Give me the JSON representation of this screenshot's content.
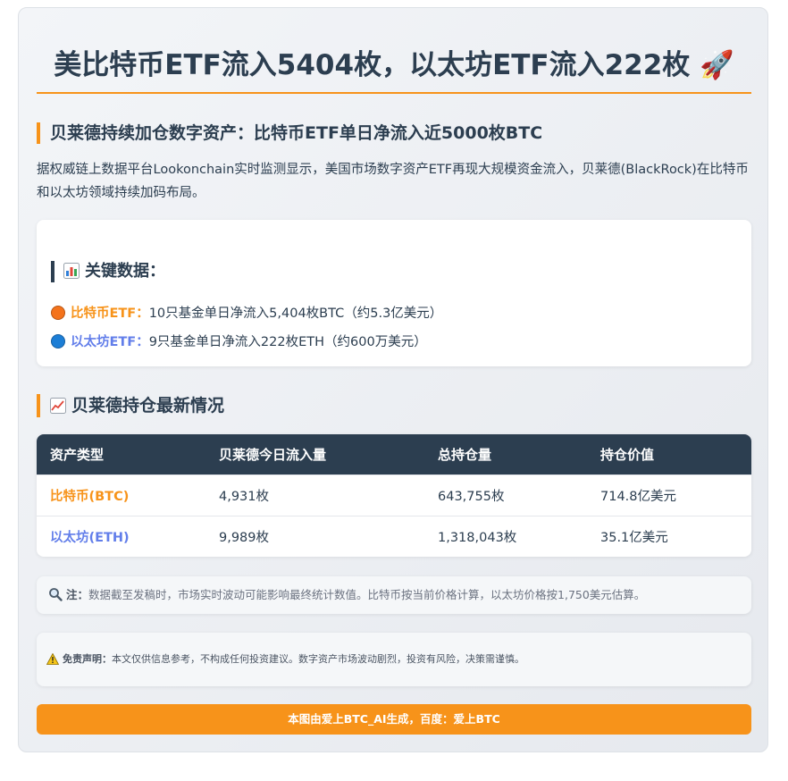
{
  "header": {
    "title": "美比特币ETF流入5404枚，以太坊ETF流入222枚",
    "rocket_icon": "🚀"
  },
  "section1": {
    "heading": "贝莱德持续加仓数字资产：比特币ETF单日净流入近5000枚BTC",
    "intro": "据权威链上数据平台Lookonchain实时监测显示，美国市场数字资产ETF再现大规模资金流入，贝莱德(BlackRock)在比特币和以太坊领域持续加码布局。"
  },
  "key_data": {
    "heading": "关键数据：",
    "heading_icon": "bar-chart-icon",
    "items": [
      {
        "label": "比特币ETF：",
        "text": "10只基金单日净流入5,404枚BTC（约5.3亿美元）",
        "dot_color": "#f4731c"
      },
      {
        "label": "以太坊ETF：",
        "text": "9只基金单日净流入222枚ETH（约600万美元）",
        "dot_color": "#1c7ed6"
      }
    ]
  },
  "section2": {
    "heading": "贝莱德持仓最新情况",
    "heading_icon": "trend-up-chart-icon"
  },
  "table": {
    "headers": [
      "资产类型",
      "贝莱德今日流入量",
      "总持仓量",
      "持仓价值"
    ],
    "rows": [
      [
        "比特币(BTC)",
        "4,931枚",
        "643,755枚",
        "714.8亿美元"
      ],
      [
        "以太坊(ETH)",
        "9,989枚",
        "1,318,043枚",
        "35.1亿美元"
      ]
    ]
  },
  "note": {
    "icon": "magnifier-icon",
    "label": "注：",
    "text": "数据截至发稿时，市场实时波动可能影响最终统计数值。比特币按当前价格计算，以太坊价格按1,750美元估算。"
  },
  "disclaimer": {
    "icon": "warning-icon",
    "label": "免责声明：",
    "text": "本文仅供信息参考，不构成任何投资建议。数字资产市场波动剧烈，投资有风险，决策需谨慎。"
  },
  "footer": {
    "text": "本图由爱上BTC_AI生成，百度：爱上BTC"
  },
  "colors": {
    "accent": "#f7931a",
    "dark": "#2c3e50",
    "btc": "#f7931a",
    "eth": "#627eea"
  }
}
